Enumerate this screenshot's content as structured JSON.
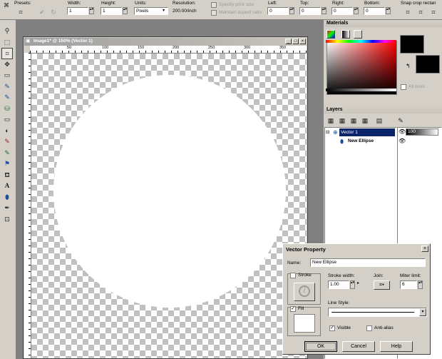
{
  "toolbar": {
    "presets_label": "Presets:",
    "width_label": "Width:",
    "width_value": "1",
    "height_label": "Height:",
    "height_value": "1",
    "units_label": "Units:",
    "units_value": "Pixels",
    "resolution_label": "Resolution:",
    "resolution_value": "200.00/inch",
    "specify_print_size": "Specify print size",
    "maintain_aspect_ratio": "Maintain aspect ratio",
    "left_label": "Left:",
    "left_value": "0",
    "top_label": "Top:",
    "top_value": "0",
    "right_label": "Right:",
    "right_value": "0",
    "bottom_label": "Bottom:",
    "bottom_value": "0",
    "snap_label": "Snap crop rectan"
  },
  "image_window": {
    "title": "Image1* @ 150% (Vector 1)",
    "ruler_top": [
      "50",
      "100",
      "150",
      "200",
      "250",
      "300",
      "350"
    ]
  },
  "materials": {
    "title": "Materials",
    "all_tools": "All tools"
  },
  "layers": {
    "title": "Layers",
    "layer_name": "Vector 1",
    "opacity": "100",
    "child_name": "New Ellipse"
  },
  "dialog": {
    "title": "Vector Property",
    "name_label": "Name:",
    "name_value": "New Ellipse",
    "stroke_label": "Stroke",
    "stroke_width_label": "Stroke width:",
    "stroke_width_value": "1.00",
    "join_label": "Join:",
    "miter_label": "Miter limit:",
    "miter_value": "6",
    "fill_label": "Fill",
    "line_style_label": "Line Style:",
    "visible_label": "Visible",
    "antialias_label": "Anti-alias",
    "ok": "OK",
    "cancel": "Cancel",
    "help": "Help"
  },
  "colors": {
    "app_bg": "#d4d0c8",
    "workspace_bg": "#808080",
    "title_active": "#0a246a",
    "foreground": "#000000",
    "background": "#000000"
  }
}
